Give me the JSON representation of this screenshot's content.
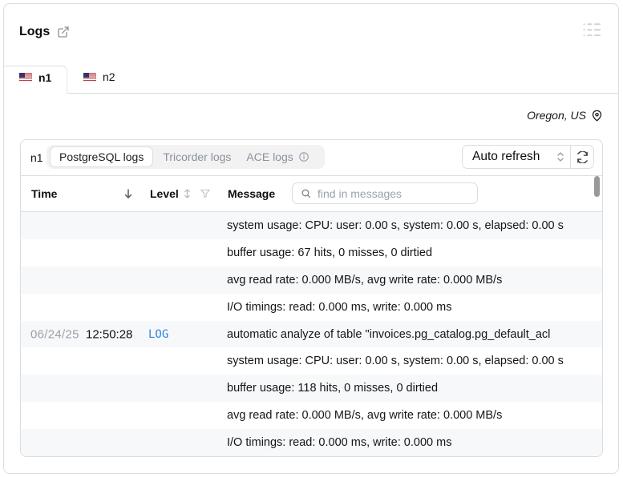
{
  "card": {
    "title": "Logs"
  },
  "instance_tabs": [
    {
      "label": "n1",
      "active": true
    },
    {
      "label": "n2",
      "active": false
    }
  ],
  "region": {
    "label": "Oregon, US"
  },
  "toolbar": {
    "node_label": "n1",
    "log_source_tabs": [
      {
        "label": "PostgreSQL logs",
        "active": true
      },
      {
        "label": "Tricorder logs",
        "active": false
      },
      {
        "label": "ACE logs",
        "active": false,
        "info": true
      }
    ],
    "auto_refresh_label": "Auto refresh"
  },
  "table": {
    "columns": {
      "time": "Time",
      "level": "Level",
      "message": "Message"
    },
    "search_placeholder": "find in messages",
    "rows": [
      {
        "date": "",
        "time": "",
        "level": "",
        "message": "system usage: CPU: user: 0.00 s, system: 0.00 s, elapsed: 0.00 s"
      },
      {
        "date": "",
        "time": "",
        "level": "",
        "message": "buffer usage: 67 hits, 0 misses, 0 dirtied"
      },
      {
        "date": "",
        "time": "",
        "level": "",
        "message": "avg read rate: 0.000 MB/s, avg write rate: 0.000 MB/s"
      },
      {
        "date": "",
        "time": "",
        "level": "",
        "message": "I/O timings: read: 0.000 ms, write: 0.000 ms"
      },
      {
        "date": "06/24/25",
        "time": "12:50:28",
        "level": "LOG",
        "message": "automatic analyze of table \"invoices.pg_catalog.pg_default_acl"
      },
      {
        "date": "",
        "time": "",
        "level": "",
        "message": "system usage: CPU: user: 0.00 s, system: 0.00 s, elapsed: 0.00 s"
      },
      {
        "date": "",
        "time": "",
        "level": "",
        "message": "buffer usage: 118 hits, 0 misses, 0 dirtied"
      },
      {
        "date": "",
        "time": "",
        "level": "",
        "message": "avg read rate: 0.000 MB/s, avg write rate: 0.000 MB/s"
      },
      {
        "date": "",
        "time": "",
        "level": "",
        "message": "I/O timings: read: 0.000 ms, write: 0.000 ms"
      }
    ]
  },
  "colors": {
    "accent_blue": "#2e83e2",
    "border": "#d9dee2",
    "stripe": "#f7f8f9",
    "scrollbar": "#999999"
  }
}
